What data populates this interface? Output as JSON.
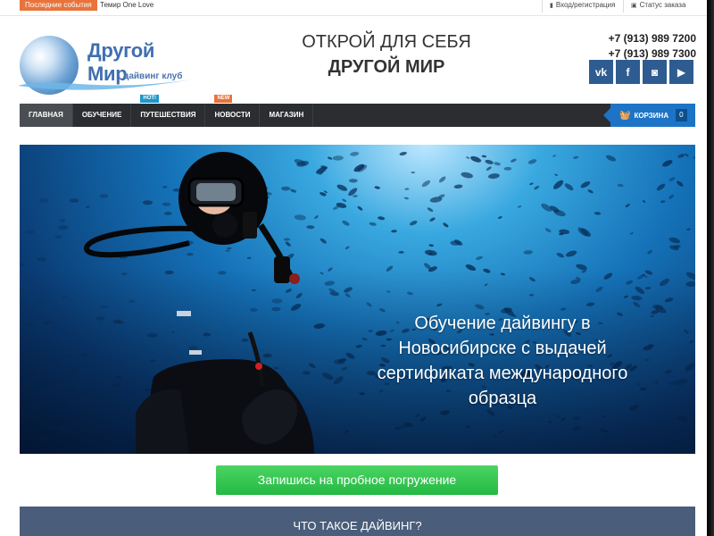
{
  "topbar": {
    "news_label": "Последние события",
    "news_text": "Темир One Love",
    "login_label": "Вход/регистрация",
    "status_label": "Статус заказа"
  },
  "logo": {
    "title": "Другой Мир",
    "subtitle": "дайвинг клуб"
  },
  "slogan": {
    "line1": "ОТКРОЙ ДЛЯ СЕБЯ",
    "line2": "ДРУГОЙ МИР"
  },
  "contacts": {
    "phone1": "+7 (913) 989 7200",
    "phone2": "+7 (913) 989 7300"
  },
  "social": [
    {
      "name": "vk-icon",
      "glyph": "vk"
    },
    {
      "name": "facebook-icon",
      "glyph": "f"
    },
    {
      "name": "instagram-icon",
      "glyph": "◙"
    },
    {
      "name": "youtube-icon",
      "glyph": "▶"
    }
  ],
  "nav": {
    "items": [
      {
        "label": "ГЛАВНАЯ",
        "active": true
      },
      {
        "label": "ОБУЧЕНИЕ"
      },
      {
        "label": "ПУТЕШЕСТВИЯ",
        "badge": "HOT!"
      },
      {
        "label": "НОВОСТИ",
        "badge": "NEW"
      },
      {
        "label": "МАГАЗИН"
      }
    ]
  },
  "cart": {
    "label": "КОРЗИНА",
    "count": "0"
  },
  "hero": {
    "line1": "Обучение дайвингу в",
    "line2": "Новосибирске с выдачей",
    "line3": "сертификата международного",
    "line4": "образца"
  },
  "cta": {
    "label": "Запишись на пробное погружение"
  },
  "section": {
    "title": "ЧТО ТАКОЕ ДАЙВИНГ?"
  },
  "colors": {
    "nav_bg": "#2b2d30",
    "cart_bg": "#1d74c6",
    "social_bg": "#2f5c90",
    "cta_bg": "#25b944",
    "section_bg": "#4a5d7a",
    "badge_hot": "#1f97c9",
    "badge_new": "#e8743b"
  }
}
